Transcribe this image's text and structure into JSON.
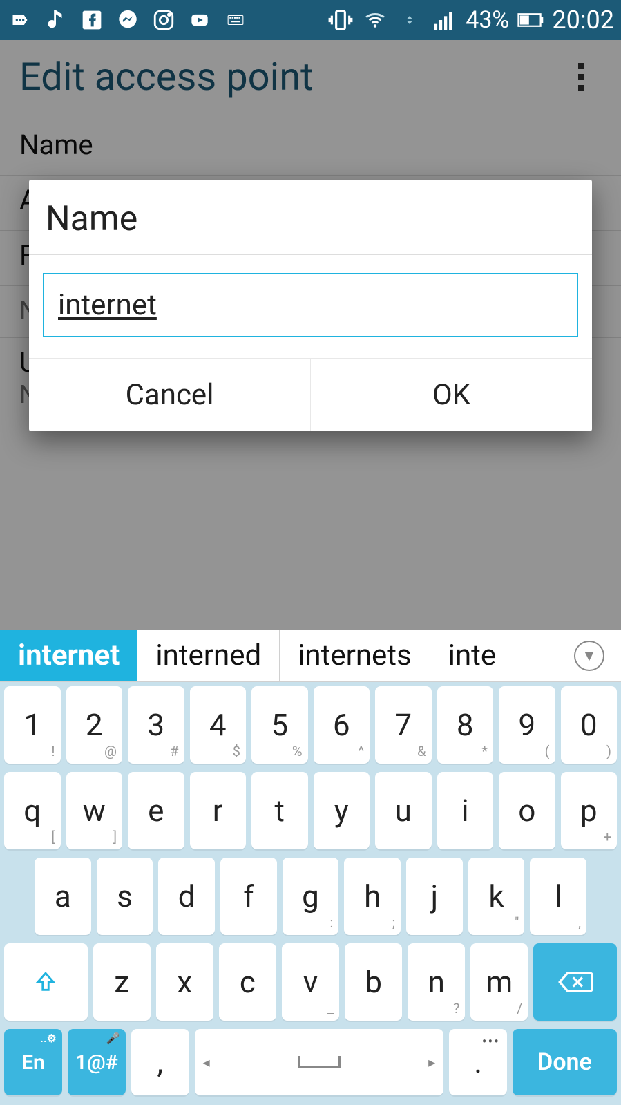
{
  "statusbar": {
    "battery_pct": "43%",
    "clock": "20:02"
  },
  "page": {
    "title": "Edit access point",
    "fields": [
      {
        "label": "Name",
        "value": ""
      },
      {
        "label": "A",
        "value": ""
      },
      {
        "label": "F",
        "value": ""
      },
      {
        "label": "",
        "value": "Not set"
      },
      {
        "label": "Username",
        "value": "Not set"
      }
    ]
  },
  "dialog": {
    "title": "Name",
    "input_value": "internet",
    "cancel": "Cancel",
    "ok": "OK"
  },
  "suggestions": [
    "internet",
    "interned",
    "internets",
    "inte"
  ],
  "keyboard": {
    "row1": [
      {
        "m": "1",
        "s": "!"
      },
      {
        "m": "2",
        "s": "@"
      },
      {
        "m": "3",
        "s": "#"
      },
      {
        "m": "4",
        "s": "$"
      },
      {
        "m": "5",
        "s": "%"
      },
      {
        "m": "6",
        "s": "^"
      },
      {
        "m": "7",
        "s": "&"
      },
      {
        "m": "8",
        "s": "*"
      },
      {
        "m": "9",
        "s": "("
      },
      {
        "m": "0",
        "s": ")"
      }
    ],
    "row2": [
      {
        "m": "q",
        "s": "["
      },
      {
        "m": "w",
        "s": "]"
      },
      {
        "m": "e",
        "s": ""
      },
      {
        "m": "r",
        "s": ""
      },
      {
        "m": "t",
        "s": ""
      },
      {
        "m": "y",
        "s": ""
      },
      {
        "m": "u",
        "s": ""
      },
      {
        "m": "i",
        "s": ""
      },
      {
        "m": "o",
        "s": ""
      },
      {
        "m": "p",
        "s": "+"
      }
    ],
    "row3": [
      {
        "m": "a",
        "s": ""
      },
      {
        "m": "s",
        "s": ""
      },
      {
        "m": "d",
        "s": ""
      },
      {
        "m": "f",
        "s": ""
      },
      {
        "m": "g",
        "s": ":"
      },
      {
        "m": "h",
        "s": ";"
      },
      {
        "m": "j",
        "s": ""
      },
      {
        "m": "k",
        "s": "\""
      },
      {
        "m": "l",
        "s": ","
      }
    ],
    "row4": [
      {
        "m": "z",
        "s": ""
      },
      {
        "m": "x",
        "s": ""
      },
      {
        "m": "c",
        "s": ""
      },
      {
        "m": "v",
        "s": "_"
      },
      {
        "m": "b",
        "s": ""
      },
      {
        "m": "n",
        "s": "?"
      },
      {
        "m": "m",
        "s": "/"
      }
    ],
    "bottom": {
      "lang": "En",
      "sym": "1@#",
      "comma": ",",
      "dot": ".",
      "done": "Done"
    }
  }
}
